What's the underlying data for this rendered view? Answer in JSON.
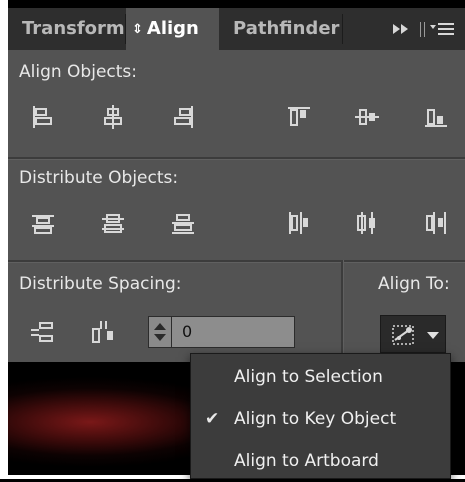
{
  "tabs": [
    {
      "label": "Transform"
    },
    {
      "label": "Align"
    },
    {
      "label": "Pathfinder"
    }
  ],
  "header": {
    "expand_icon": "double-chevron-right-icon",
    "menu_icon": "panel-menu-icon"
  },
  "sections": {
    "align_objects": "Align Objects:",
    "distribute_objects": "Distribute Objects:",
    "distribute_spacing": "Distribute Spacing:",
    "align_to": "Align To:"
  },
  "align_objects_buttons": [
    "horizontal-align-left-icon",
    "horizontal-align-center-icon",
    "horizontal-align-right-icon",
    "vertical-align-top-icon",
    "vertical-align-center-icon",
    "vertical-align-bottom-icon"
  ],
  "distribute_objects_buttons": [
    "vertical-distribute-top-icon",
    "vertical-distribute-center-icon",
    "vertical-distribute-bottom-icon",
    "horizontal-distribute-left-icon",
    "horizontal-distribute-center-icon",
    "horizontal-distribute-right-icon"
  ],
  "distribute_spacing_buttons": [
    "vertical-distribute-space-icon",
    "horizontal-distribute-space-icon"
  ],
  "spacing_value": "0",
  "align_to_menu": {
    "items": [
      {
        "label": "Align to Selection",
        "checked": false
      },
      {
        "label": "Align to Key Object",
        "checked": true
      },
      {
        "label": "Align to Artboard",
        "checked": false
      }
    ],
    "check_glyph": "✔"
  },
  "colors": {
    "panel_bg": "#535353",
    "tab_bar_bg": "#2e2e2e",
    "menu_bg": "#3c3c3c"
  }
}
